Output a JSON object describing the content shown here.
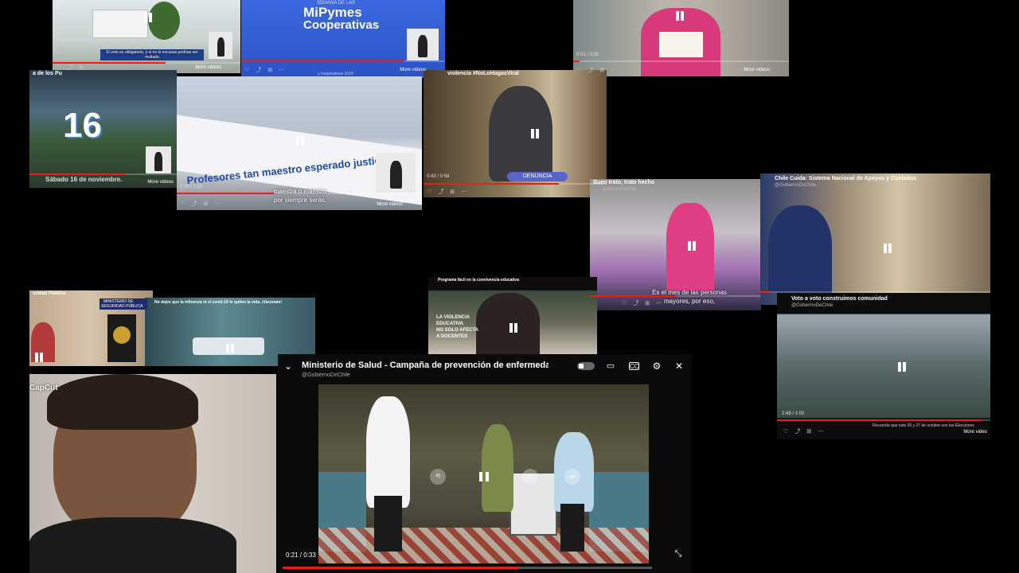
{
  "tiles": {
    "t1": {
      "caption": "El voto es obligatorio, y si no lo excusas podrías ser multado",
      "more": "More videos"
    },
    "t2": {
      "title": "MiPymes",
      "title2": "Cooperativas",
      "top": "SEMANA DE LAS",
      "bottom": "y cooperativas 2024",
      "more": "More videos"
    },
    "t3": {
      "time": "0:01 / 0:30",
      "more": "More videos"
    },
    "t4": {
      "header": "a de los Pu",
      "number": "16",
      "caption": "Sábado 16 de noviembre.",
      "more": "More videos"
    },
    "t5": {
      "banner": "Profesores tan maestro esperado justicia",
      "caption1": "maestra o maestro",
      "caption2": "por siempre serás.",
      "time": "0:29 / 1:12",
      "more": "More videos"
    },
    "t6": {
      "title": "violencia #NoLoHagasViral",
      "button": "DENUNCIA",
      "time": "0:43 / 0:58"
    },
    "t7": {
      "title": "Buen trato, trato hecho",
      "sub": "gobiernodechile",
      "caption1": "Es el mes de las personas",
      "caption2": "mayores, por eso,"
    },
    "t8": {
      "title": "Chile Cuida: Sistema Nacional de Apoyos y Cuidados",
      "sub": "@GobiernoDeChile"
    },
    "t9": {
      "title": "Voto a voto construimos comunidad",
      "sub": "@GobiernoDeChile",
      "time": "2:48 / 1:00",
      "caption": "Recuerda que este 26 y 27 de octubre son las Elecciones",
      "more": "More video"
    },
    "t10": {
      "title": "Programa fácil en la convivencia educativa",
      "text1": "LA VIOLENCIA",
      "text2": "EDUCATIVA",
      "text3": "NO SOLO AFECTA",
      "text4": "A DOCENTES"
    },
    "t11": {
      "title": "uridad Pública",
      "sign1": "MINISTERIO DE",
      "sign2": "SEGURIDAD PÚBLICA"
    },
    "t12": {
      "title": "No dejes que la influenza ni el covid-19 te quiten la vida. ¡Vacúnate!"
    }
  },
  "capcut": {
    "label": "CapCut"
  },
  "main": {
    "title": "Ministerio de Salud - Campaña de prevención de enfermedad",
    "channel": "@GobiernoDeChile",
    "time": "0:21 / 0:33",
    "progress": 0.64
  }
}
